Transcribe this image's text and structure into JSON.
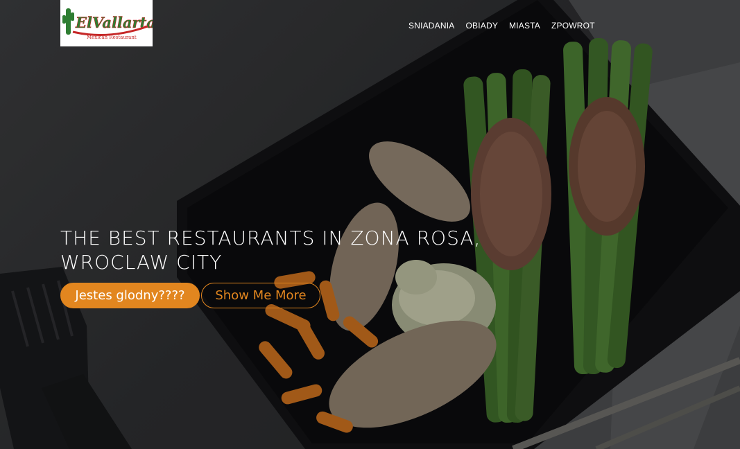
{
  "brand": {
    "logo_title": "ElVallarta",
    "logo_subtitle": "Mexican Restaurant"
  },
  "nav": {
    "items": [
      {
        "label": "SNIADANIA"
      },
      {
        "label": "OBIADY"
      },
      {
        "label": "MIASTA"
      },
      {
        "label": "ZPOWROT"
      }
    ]
  },
  "hero": {
    "headline_line1": "THE BEST RESTAURANTS IN ZONA ROSA,",
    "headline_line2": "WROCLAW CITY",
    "primary_button": "Jestes glodny????",
    "secondary_button": "Show Me More"
  },
  "colors": {
    "accent": "#e2861f",
    "nav_text": "#ffffff",
    "logo_green": "#2e7d32",
    "logo_red": "#c62828"
  }
}
